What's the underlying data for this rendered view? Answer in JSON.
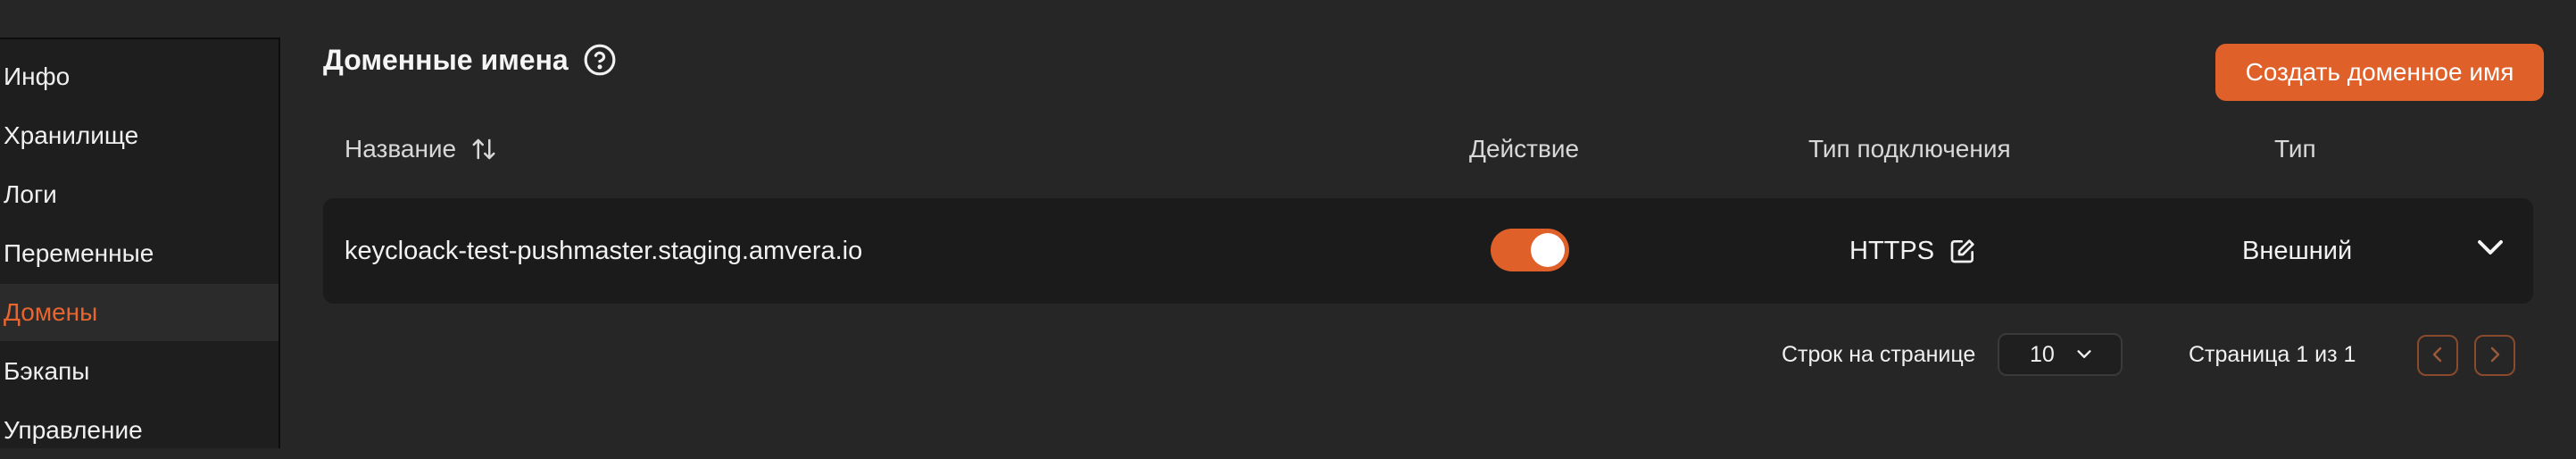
{
  "sidebar": {
    "items": [
      {
        "label": "Инфо",
        "active": false
      },
      {
        "label": "Хранилище",
        "active": false
      },
      {
        "label": "Логи",
        "active": false
      },
      {
        "label": "Переменные",
        "active": false
      },
      {
        "label": "Домены",
        "active": true
      },
      {
        "label": "Бэкапы",
        "active": false
      },
      {
        "label": "Управление",
        "active": false
      }
    ]
  },
  "header": {
    "title": "Доменные имена",
    "help_icon": "question-circle-icon",
    "create_button": "Создать доменное имя"
  },
  "table": {
    "columns": {
      "name": "Название",
      "action": "Действие",
      "connection_type": "Тип подключения",
      "type": "Тип"
    },
    "sort_icon": "sort-arrows-icon",
    "rows": [
      {
        "name": "keycloack-test-pushmaster.staging.amvera.io",
        "enabled": true,
        "connection_type": "HTTPS",
        "type": "Внешний"
      }
    ]
  },
  "pagination": {
    "rows_per_page_label": "Строк на странице",
    "rows_per_page_value": "10",
    "page_info": "Страница 1 из 1"
  },
  "colors": {
    "accent": "#e0602a",
    "background": "#262626",
    "row_background": "#1b1b1b",
    "sidebar_background": "#1e1e1e"
  }
}
